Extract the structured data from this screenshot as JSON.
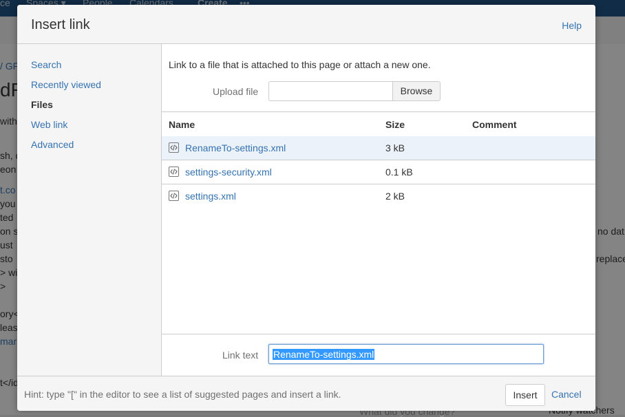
{
  "background": {
    "topbar_items": [
      "ce",
      "Spaces ▾",
      "People",
      "Calendars",
      "Create",
      "•••"
    ],
    "page_text_left": [
      "/ GF",
      "dR",
      "with",
      "sh, d",
      "eon",
      "t.co",
      "you",
      "ted",
      "on s",
      "ust",
      "sto",
      "> wi",
      ">",
      "ory<",
      "leas",
      "mar",
      "t</id"
    ],
    "page_text_right": [
      "no dat",
      "replace",
      "Notify watchers",
      "What did you change?"
    ]
  },
  "dialog": {
    "title": "Insert link",
    "help_label": "Help",
    "nav": [
      {
        "label": "Search",
        "selected": false
      },
      {
        "label": "Recently viewed",
        "selected": false
      },
      {
        "label": "Files",
        "selected": true
      },
      {
        "label": "Web link",
        "selected": false
      },
      {
        "label": "Advanced",
        "selected": false
      }
    ],
    "files_panel": {
      "intro": "Link to a file that is attached to this page or attach a new one.",
      "upload_label": "Upload file",
      "upload_value": "",
      "browse_label": "Browse",
      "columns": {
        "name": "Name",
        "size": "Size",
        "comment": "Comment"
      },
      "rows": [
        {
          "name": "RenameTo-settings.xml",
          "size": "3 kB",
          "comment": "",
          "selected": true,
          "icon": "xml-file-icon"
        },
        {
          "name": "settings-security.xml",
          "size": "0.1 kB",
          "comment": "",
          "selected": false,
          "icon": "xml-file-icon"
        },
        {
          "name": "settings.xml",
          "size": "2 kB",
          "comment": "",
          "selected": false,
          "icon": "xml-file-icon"
        }
      ]
    },
    "link_text_label": "Link text",
    "link_text_value": "RenameTo-settings.xml",
    "footer": {
      "hint": "Hint: type \"[\" in the editor to see a list of suggested pages and insert a link.",
      "insert_label": "Insert",
      "cancel_label": "Cancel"
    }
  },
  "colors": {
    "link": "#3572b0",
    "brand_bar": "#205081",
    "selection": "#ebf2f9"
  }
}
